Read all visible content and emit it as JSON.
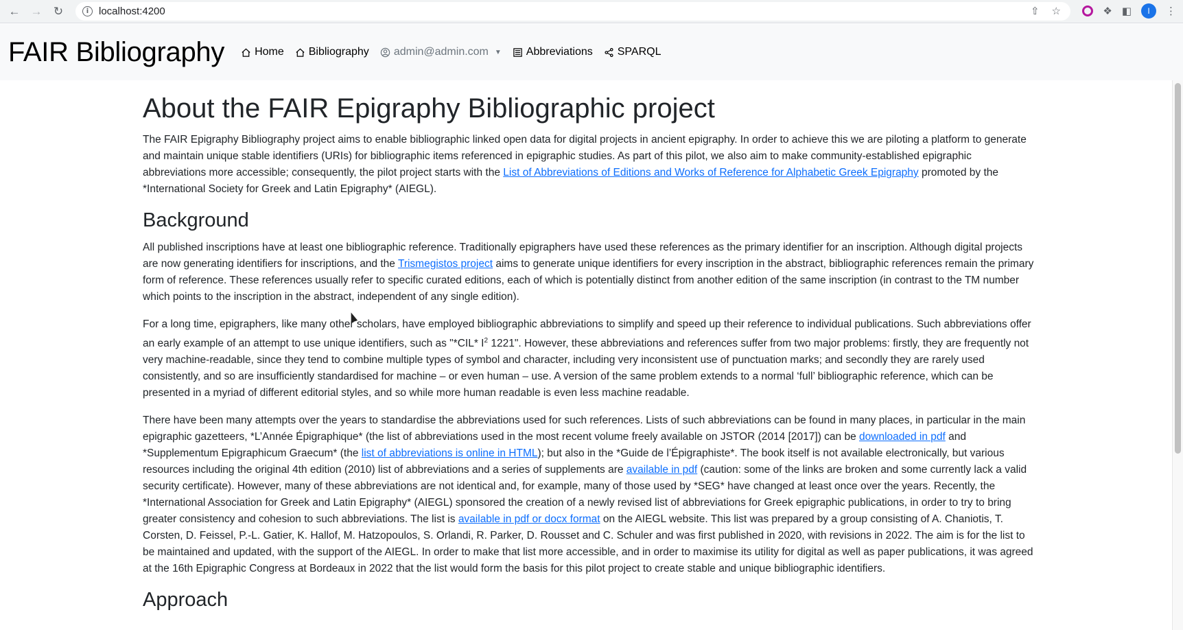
{
  "browser": {
    "url": "localhost:4200",
    "avatar_letter": "I"
  },
  "app": {
    "brand": "FAIR Bibliography",
    "nav": {
      "home": "Home",
      "bibliography": "Bibliography",
      "user": "admin@admin.com",
      "abbreviations": "Abbreviations",
      "sparql": "SPARQL"
    }
  },
  "page": {
    "title": "About the FAIR Epigraphy Bibliographic project",
    "intro": {
      "text1": "The FAIR Epigraphy Bibliography project aims to enable bibliographic linked open data for digital projects in ancient epigraphy. In order to achieve this we are piloting a platform to generate and maintain unique stable identifiers (URIs) for bibliographic items referenced in epigraphic studies. As part of this pilot, we also aim to make community-established epigraphic abbreviations more accessible; consequently, the pilot project starts with the ",
      "link1": "List of Abbreviations of Editions and Works of Reference for Alphabetic Greek Epigraphy",
      "text2": " promoted by the *International Society for Greek and Latin Epigraphy* (AIEGL)."
    },
    "background_heading": "Background",
    "bg_p1": {
      "text1": "All published inscriptions have at least one bibliographic reference. Traditionally epigraphers have used these references as the primary identifier for an inscription. Although digital projects are now generating identifiers for inscriptions, and the ",
      "link1": "Trismegistos project",
      "text2": " aims to generate unique identifiers for every inscription in the abstract, bibliographic references remain the primary form of reference. These references usually refer to specific curated editions, each of which is potentially distinct from another edition of the same inscription (in contrast to the TM number which points to the inscription in the abstract, independent of any single edition)."
    },
    "bg_p2": {
      "text1": "For a long time, epigraphers, like many other scholars, have employed bibliographic abbreviations to simplify and speed up their reference to individual publications. Such abbreviations offer an early example of an attempt to use unique identifiers, such as \"*CIL* I",
      "sup": "2",
      "text2": " 1221\". However, these abbreviations and references suffer from two major problems: firstly, they are frequently not very machine-readable, since they tend to combine multiple types of symbol and character, including very inconsistent use of punctuation marks; and secondly they are rarely used consistently, and so are insufficiently standardised for machine – or even human – use. A version of the same problem extends to a normal ‘full’ bibliographic reference, which can be presented in a myriad of different editorial styles, and so while more human readable is even less machine readable."
    },
    "bg_p3": {
      "text1": "There have been many attempts over the years to standardise the abbreviations used for such references. Lists of such abbreviations can be found in many places, in particular in the main epigraphic gazetteers, *L’Année Épigraphique* (the list of abbreviations used in the most recent volume freely available on JSTOR (2014 [2017]) can be ",
      "link1": "downloaded in pdf",
      "text2": " and *Supplementum Epigraphicum Graecum* (the ",
      "link2": "list of abbreviations is online in HTML",
      "text3": "); but also in the *Guide de l’Épigraphiste*. The book itself is not available electronically, but various resources including the original 4th edition (2010) list of abbreviations and a series of supplements are ",
      "link3": "available in pdf",
      "text4": " (caution: some of the links are broken and some currently lack a valid security certificate). However, many of these abbreviations are not identical and, for example, many of those used by *SEG* have changed at least once over the years. Recently, the *International Association for Greek and Latin Epigraphy* (AIEGL) sponsored the creation of a newly revised list of abbreviations for Greek epigraphic publications, in order to try to bring greater consistency and cohesion to such abbreviations. The list is ",
      "link4": "available in pdf or docx format",
      "text5": " on the AIEGL website. This list was prepared by a group consisting of A. Chaniotis, T. Corsten, D. Feissel, P.-L. Gatier, K. Hallof, M. Hatzopoulos, S. Orlandi, R. Parker, D. Rousset and C. Schuler and was first published in 2020, with revisions in 2022. The aim is for the list to be maintained and updated, with the support of the AIEGL. In order to make that list more accessible, and in order to maximise its utility for digital as well as paper publications, it was agreed at the 16th Epigraphic Congress at Bordeaux in 2022 that the list would form the basis for this pilot project to create stable and unique bibliographic identifiers."
    },
    "approach_heading": "Approach"
  }
}
